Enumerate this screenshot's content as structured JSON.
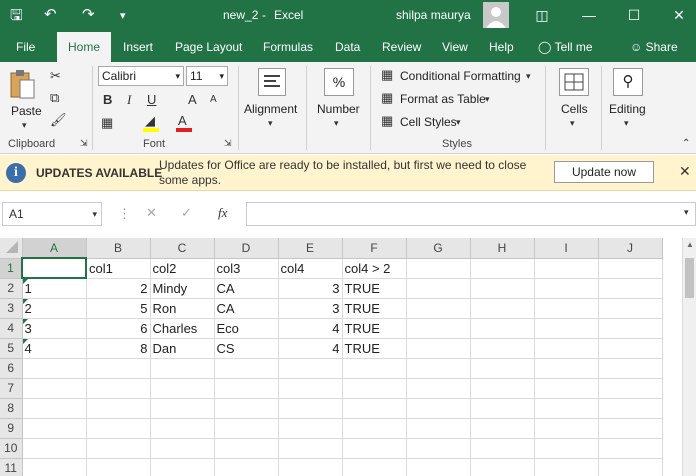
{
  "window": {
    "filename": "new_2",
    "separator": "-",
    "app": "Excel",
    "user": "shilpa maurya"
  },
  "tabs": [
    "File",
    "Home",
    "Insert",
    "Page Layout",
    "Formulas",
    "Data",
    "Review",
    "View",
    "Help"
  ],
  "tell_me": "Tell me",
  "share": "Share",
  "ribbon": {
    "paste": "Paste",
    "clipboard": "Clipboard",
    "font_name": "Calibri",
    "font_size": "11",
    "font_group": "Font",
    "bold": "B",
    "italic": "I",
    "underline": "U",
    "grow": "A",
    "shrink": "A",
    "alignment": "Alignment",
    "number": "Number",
    "percent": "%",
    "cond_format": "Conditional Formatting",
    "format_table": "Format as Table",
    "cell_styles": "Cell Styles",
    "styles_group": "Styles",
    "cells": "Cells",
    "editing": "Editing"
  },
  "update": {
    "title": "UPDATES AVAILABLE",
    "message": "Updates for Office are ready to be installed, but first we need to close some apps.",
    "button": "Update now"
  },
  "formula_bar": {
    "name_box": "A1",
    "fx": "fx",
    "value": ""
  },
  "columns": [
    "A",
    "B",
    "C",
    "D",
    "E",
    "F",
    "G",
    "H",
    "I",
    "J"
  ],
  "rows": [
    [
      "",
      "col1",
      "col2",
      "col3",
      "col4",
      "col4 > 2",
      "",
      "",
      "",
      ""
    ],
    [
      "1",
      "2",
      "Mindy",
      "CA",
      "3",
      "TRUE",
      "",
      "",
      "",
      ""
    ],
    [
      "2",
      "5",
      "Ron",
      "CA",
      "3",
      "TRUE",
      "",
      "",
      "",
      ""
    ],
    [
      "3",
      "6",
      "Charles",
      "Eco",
      "4",
      "TRUE",
      "",
      "",
      "",
      ""
    ],
    [
      "4",
      "8",
      "Dan",
      "CS",
      "4",
      "TRUE",
      "",
      "",
      "",
      ""
    ],
    [
      "",
      "",
      "",
      "",
      "",
      "",
      "",
      "",
      "",
      ""
    ],
    [
      "",
      "",
      "",
      "",
      "",
      "",
      "",
      "",
      "",
      ""
    ],
    [
      "",
      "",
      "",
      "",
      "",
      "",
      "",
      "",
      "",
      ""
    ],
    [
      "",
      "",
      "",
      "",
      "",
      "",
      "",
      "",
      "",
      ""
    ],
    [
      "",
      "",
      "",
      "",
      "",
      "",
      "",
      "",
      "",
      ""
    ],
    [
      "",
      "",
      "",
      "",
      "",
      "",
      "",
      "",
      "",
      ""
    ]
  ],
  "row_numbers": [
    "1",
    "2",
    "3",
    "4",
    "5",
    "6",
    "7",
    "8",
    "9",
    "10",
    "11"
  ],
  "active_cell": "A1",
  "accent_color": "#217346"
}
